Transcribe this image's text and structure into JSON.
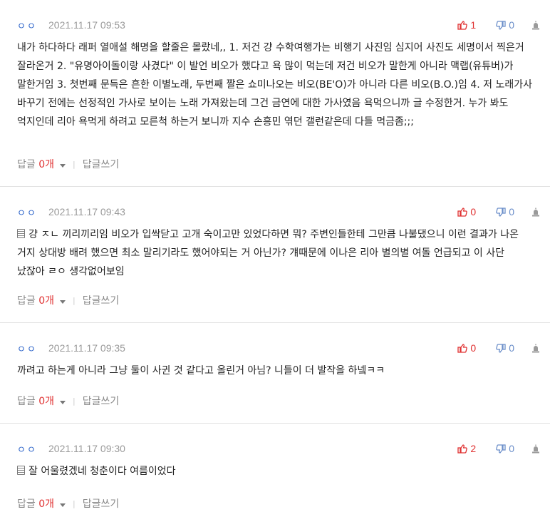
{
  "comments": [
    {
      "nick": "ㅇㅇ",
      "date": "2021.11.17 09:53",
      "upvotes": "1",
      "downvotes": "0",
      "has_memo_icon": false,
      "text": "내가 하다하다 래퍼 열애설 해명을 할줄은 몰랐네,, 1. 저건 걍 수학여행가는 비행기 사진임 심지어 사진도 세명이서 찍은거 잘라온거 2. \"유명아이돌이랑 사겼다\" 이 발언 비오가 했다고 욕 많이 먹는데 저건 비오가 말한게 아니라 맥랩(유튜버)가 말한거임 3. 첫번째 문득은 흔한 이별노래, 두번째 짤은 쇼미나오는 비오(BE'O)가 아니라 다른 비오(B.O.)임 4. 저 노래가사 바꾸기 전에는 선정적인 가사로 보이는 노래 가져왔는데 그건 금연에 대한 가사였음 욕먹으니까 글 수정한거. 누가 봐도 억지인데 리아 욕먹게 하려고 모른척 하는거 보니까 지수 손흥민 엮던 갤런같은데 다들 먹금좀;;;",
      "reply_label": "답글",
      "reply_count": "0개",
      "write_reply": "답글쓰기"
    },
    {
      "nick": "ㅇㅇ",
      "date": "2021.11.17 09:43",
      "upvotes": "0",
      "downvotes": "0",
      "has_memo_icon": true,
      "text": "걍 ㅈㄴ 끼리끼리임 비오가 입싹닫고 고개 숙이고만 있었다하면 뭐? 주변인들한테 그만큼 나불댔으니 이런 결과가 나온 거지 상대방 배려 했으면 최소 말리기라도 했어야되는 거 아닌가? 걔때문에 이나은 리아 별의별 여돌 언급되고 이 사단 났잖아 ㄹㅇ 생각없어보임",
      "reply_label": "답글",
      "reply_count": "0개",
      "write_reply": "답글쓰기"
    },
    {
      "nick": "ㅇㅇ",
      "date": "2021.11.17 09:35",
      "upvotes": "0",
      "downvotes": "0",
      "has_memo_icon": false,
      "text": "까려고 하는게 아니라 그냥 둘이 사귄 것 같다고 올린거 아님? 니들이 더 발작을 하넼ㅋㅋ",
      "reply_label": "답글",
      "reply_count": "0개",
      "write_reply": "답글쓰기"
    },
    {
      "nick": "ㅇㅇ",
      "date": "2021.11.17 09:30",
      "upvotes": "2",
      "downvotes": "0",
      "has_memo_icon": true,
      "text": "잘 어울렸겠네 청춘이다 여름이었다",
      "reply_label": "답글",
      "reply_count": "0개",
      "write_reply": "답글쓰기"
    }
  ],
  "colors": {
    "upvote": "#e03131",
    "downvote": "#6b8ec9",
    "nick": "#2a62c9",
    "date": "#9a9a9a"
  },
  "icons": {
    "upvote": "thumbs-up-icon",
    "downvote": "thumbs-down-icon",
    "report": "report-icon",
    "memo": "memo-icon",
    "dropdown": "caret-down-icon"
  }
}
